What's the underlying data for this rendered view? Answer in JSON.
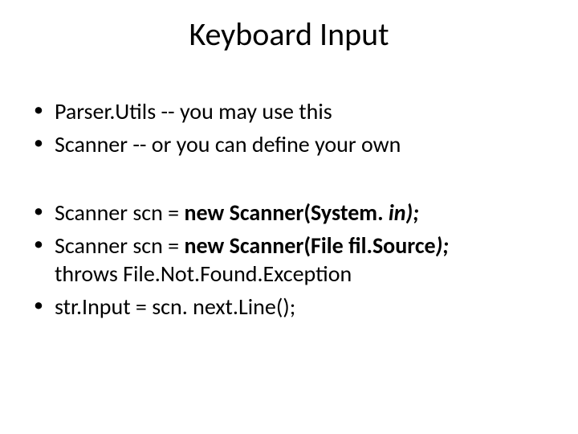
{
  "title": "Keyboard Input",
  "bullets": {
    "b1": "Parser.Utils -- you may use this",
    "b2": "Scanner -- or you can define your own",
    "b3_pre": "Scanner scn = ",
    "b3_bold": "new Scanner(System. ",
    "b3_bi": "in); ",
    "b4_pre": "Scanner scn = ",
    "b4_bold": "new Scanner(File fil.Source",
    "b4_bi": "); ",
    "b4_cont": "throws File.Not.Found.Exception",
    "b5": "str.Input = scn. next.Line();"
  }
}
